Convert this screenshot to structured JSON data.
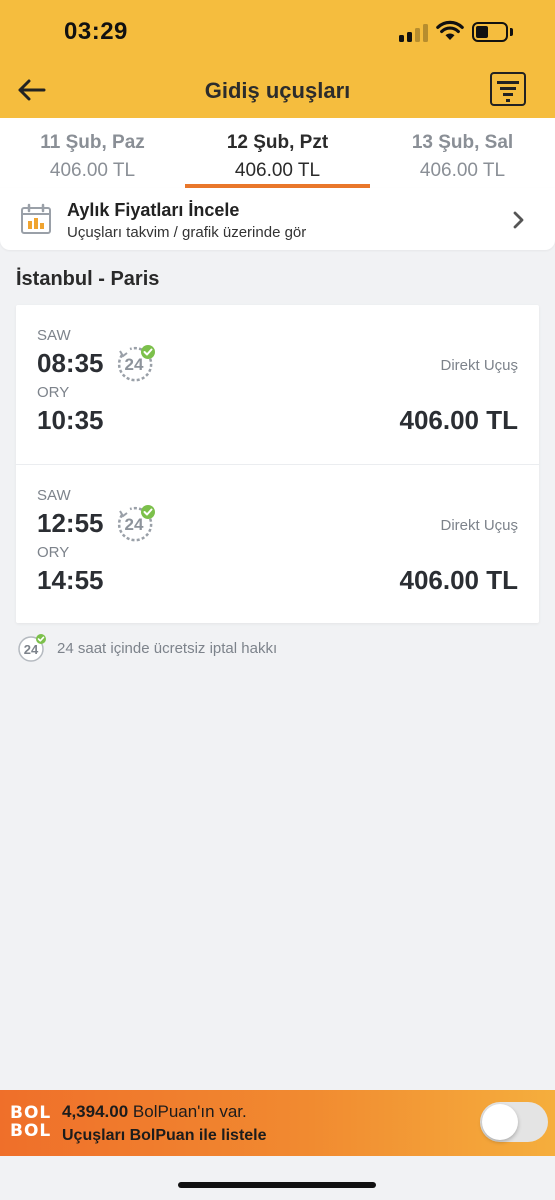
{
  "status_bar": {
    "time": "03:29"
  },
  "header": {
    "title": "Gidiş uçuşları"
  },
  "date_tabs": [
    {
      "date": "11 Şub, Paz",
      "price": "406.00 TL",
      "active": false
    },
    {
      "date": "12 Şub, Pzt",
      "price": "406.00 TL",
      "active": true
    },
    {
      "date": "13 Şub, Sal",
      "price": "406.00 TL",
      "active": false
    }
  ],
  "monthly": {
    "title": "Aylık Fiyatları İncele",
    "subtitle": "Uçuşları takvim / grafik üzerinde gör"
  },
  "route": "İstanbul - Paris",
  "flights": [
    {
      "dep_code": "SAW",
      "dep_time": "08:35",
      "arr_code": "ORY",
      "arr_time": "10:35",
      "badge": "24",
      "type": "Direkt Uçuş",
      "price": "406.00 TL"
    },
    {
      "dep_code": "SAW",
      "dep_time": "12:55",
      "arr_code": "ORY",
      "arr_time": "14:55",
      "badge": "24",
      "type": "Direkt Uçuş",
      "price": "406.00 TL"
    }
  ],
  "legend": {
    "badge": "24",
    "text": "24 saat içinde ücretsiz iptal hakkı"
  },
  "bolpuan": {
    "logo_line1": "BOL",
    "logo_line2": "BOL",
    "amount": "4,394.00",
    "amount_suffix": " BolPuan'ın var.",
    "subtitle": "Uçuşları BolPuan ile listele",
    "toggle_on": false
  },
  "colors": {
    "header": "#f5bd3e",
    "accent": "#e9772b",
    "check": "#7cc04b"
  }
}
